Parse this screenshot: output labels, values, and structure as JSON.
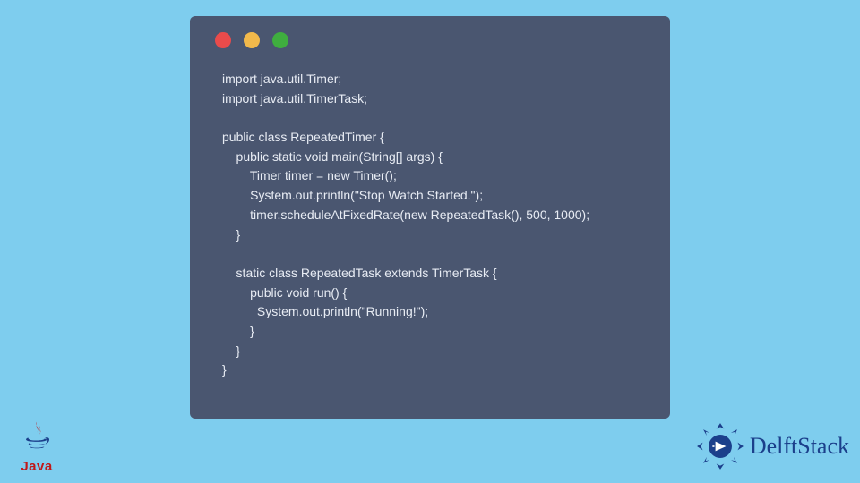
{
  "window": {
    "dots": {
      "red": "#e94b4b",
      "yellow": "#f2b94b",
      "green": "#3fae3f"
    }
  },
  "code": {
    "lines": [
      "import java.util.Timer;",
      "import java.util.TimerTask;",
      "",
      "public class RepeatedTimer {",
      "    public static void main(String[] args) {",
      "        Timer timer = new Timer();",
      "        System.out.println(\"Stop Watch Started.\");",
      "        timer.scheduleAtFixedRate(new RepeatedTask(), 500, 1000);",
      "    }",
      "",
      "    static class RepeatedTask extends TimerTask {",
      "        public void run() {",
      "          System.out.println(\"Running!\");",
      "        }",
      "    }",
      "}"
    ]
  },
  "logos": {
    "java_label": "Java",
    "delft_label": "DelftStack"
  }
}
